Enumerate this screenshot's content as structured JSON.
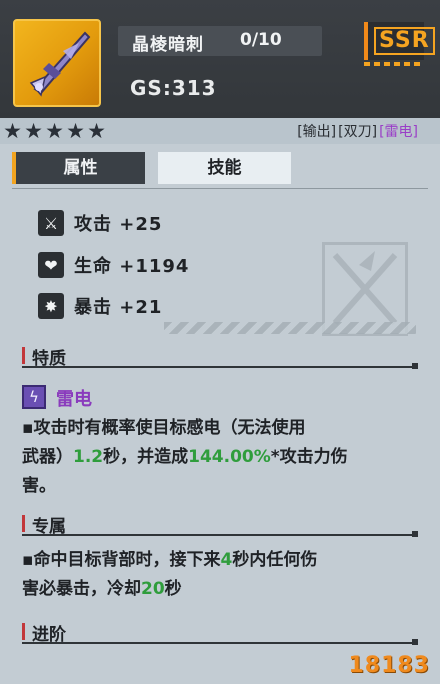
{
  "weapon": {
    "name": "晶棱暗刺",
    "count": "0/10",
    "gs": "GS:313",
    "rarity": "SSR"
  },
  "stars": [
    "★",
    "★",
    "★",
    "★",
    "★"
  ],
  "tags": {
    "role": "[输出]",
    "weapon_type": "[双刀]",
    "element": "[雷电]"
  },
  "tabs": {
    "attributes": "属性",
    "skills": "技能"
  },
  "stats": [
    {
      "icon": "sword-icon",
      "glyph": "⚔",
      "label": "攻击 +25"
    },
    {
      "icon": "heart-icon",
      "glyph": "❤",
      "label": "生命 +1194"
    },
    {
      "icon": "burst-icon",
      "glyph": "✸",
      "label": "暴击 +21"
    }
  ],
  "sections": {
    "trait": "特质",
    "exclusive": "专属",
    "advance": "进阶"
  },
  "trait": {
    "name": "雷电",
    "desc_1": "▪攻击时有概率使目标感电（无法使用",
    "desc_2a": "武器）",
    "desc_2b": "1.2",
    "desc_2c": "秒，并造成",
    "desc_2d": "144.00%",
    "desc_2e": "*攻击力伤",
    "desc_3": "害。"
  },
  "exclusive": {
    "line_1a": "▪命中目标背部时，接下来",
    "line_1b": "4",
    "line_1c": "秒内任何伤",
    "line_2a": "害必暴击，冷却",
    "line_2b": "20",
    "line_2c": "秒"
  },
  "colors": {
    "rarity": "#f5a421",
    "element": "#9a3fc7",
    "highlight": "#2f9d3c",
    "section_bar": "#c2373a"
  },
  "watermark": "18183"
}
